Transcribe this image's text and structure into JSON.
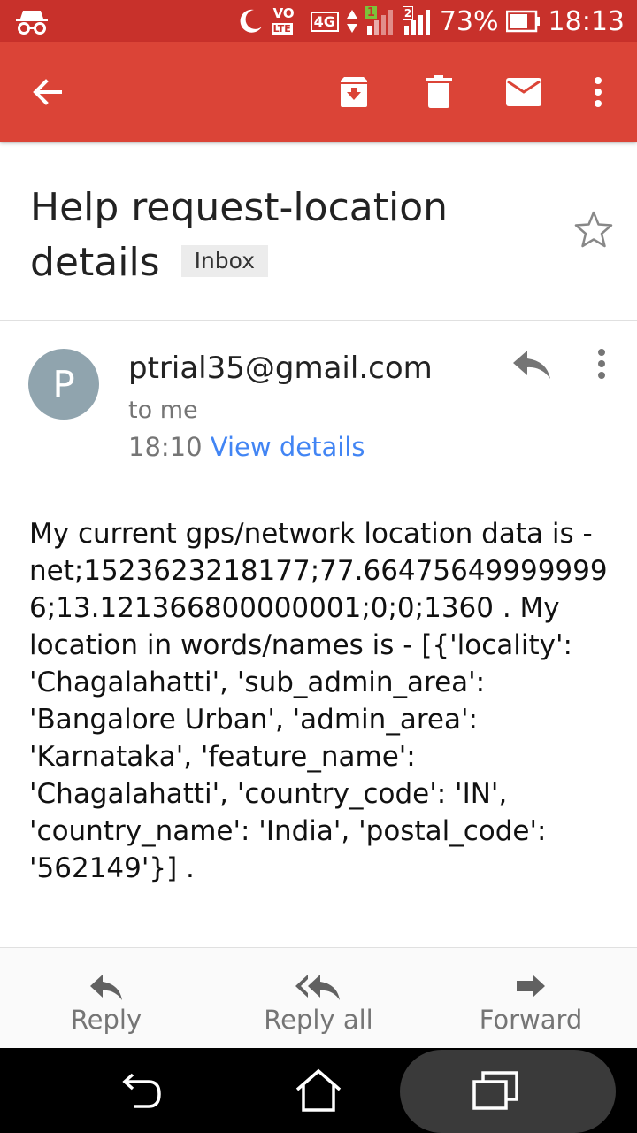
{
  "status_bar": {
    "volte": "VO",
    "lte": "LTE",
    "network": "4G",
    "sim1": "1",
    "sim2": "2",
    "battery": "73%",
    "time": "18:13"
  },
  "app_bar": {
    "icons": [
      "back-arrow-icon",
      "archive-icon",
      "delete-icon",
      "mail-icon",
      "more-vert-icon"
    ]
  },
  "email": {
    "subject": "Help request-location details",
    "label": "Inbox",
    "sender": "ptrial35@gmail.com",
    "avatar_letter": "P",
    "recipient": "to me",
    "time": "18:10",
    "view_details": "View details",
    "body": "My current gps/network location data is - net;1523623218177;77.664756499999996;13.121366800000001;0;0;1360 . My location in words/names is - [{'locality': 'Chagalahatti', 'sub_admin_area': 'Bangalore Urban', 'admin_area': 'Karnataka', 'feature_name': 'Chagalahatti', 'country_code': 'IN', 'country_name': 'India', 'postal_code': '562149'}] ."
  },
  "actions": {
    "reply": "Reply",
    "reply_all": "Reply all",
    "forward": "Forward"
  },
  "colors": {
    "status_bar": "#c8312b",
    "app_bar": "#db4437",
    "link": "#4285f4",
    "avatar": "#90a4ae"
  }
}
